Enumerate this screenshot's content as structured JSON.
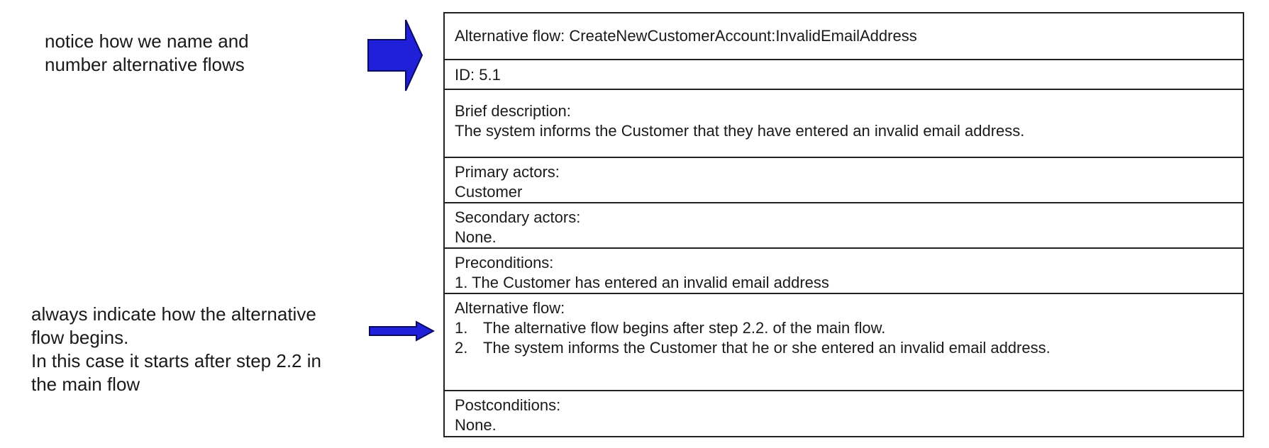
{
  "notes": {
    "top": "notice how we name and\nnumber alternative flows",
    "bottom": "always indicate how the alternative\nflow begins.\nIn this case it starts after step 2.2 in\nthe main flow"
  },
  "arrow_color": "#2020d8",
  "use_case": {
    "title": "Alternative flow: CreateNewCustomerAccount:InvalidEmailAddress",
    "id": "ID: 5.1",
    "brief_label": "Brief description:",
    "brief_text": "The system informs the Customer that they have entered an invalid email address.",
    "primary_label": "Primary actors:",
    "primary_text": "Customer",
    "secondary_label": "Secondary actors:",
    "secondary_text": "None.",
    "pre_label": "Preconditions:",
    "pre_text": "1. The Customer has entered an invalid email address",
    "alt_label": "Alternative flow:",
    "alt_steps": [
      {
        "num": "1.",
        "text": "The alternative flow begins after step 2.2. of the main flow."
      },
      {
        "num": "2.",
        "text": "The system informs the Customer that he or she entered an invalid email address."
      }
    ],
    "post_label": "Postconditions:",
    "post_text": "None."
  }
}
